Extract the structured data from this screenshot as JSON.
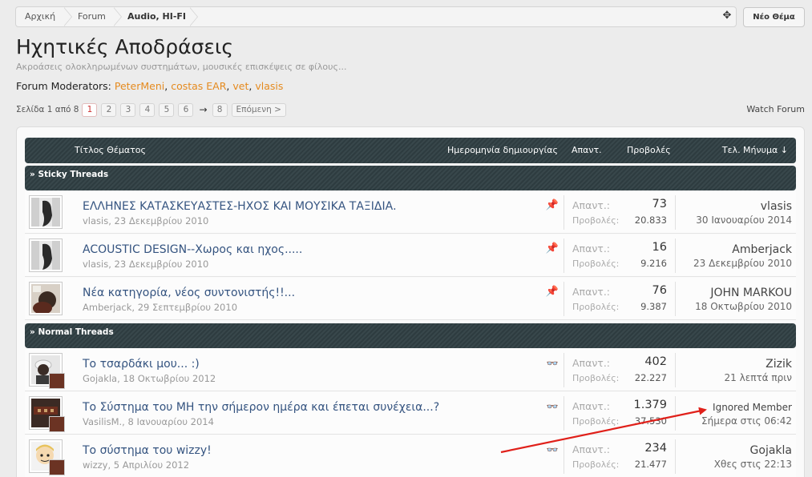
{
  "breadcrumb": [
    "Αρχική",
    "Forum",
    "Audio, HI-FI"
  ],
  "new_thread_label": "Νέο Θέμα",
  "forum": {
    "title": "Ηχητικές Αποδράσεις",
    "subtitle": "Ακροάσεις ολοκληρωμένων συστημάτων, μουσικές επισκέψεις σε φίλους...",
    "moderators_label": "Forum Moderators:",
    "moderators": [
      "PeterMeni",
      "costas EAR",
      "vet",
      "vlasis"
    ]
  },
  "pagination": {
    "label": "Σελίδα 1 από 8",
    "pages": [
      "1",
      "2",
      "3",
      "4",
      "5",
      "6"
    ],
    "arrow": "→",
    "last": "8",
    "next": "Επόμενη >"
  },
  "watch_forum": "Watch Forum",
  "table_header": {
    "title": "Τίτλος Θέματος",
    "date": "Ημερομηνία δημιουργίας",
    "replies": "Απαντ.",
    "views": "Προβολές",
    "last": "Τελ. Μήνυμα ↓"
  },
  "sections": {
    "sticky": "» Sticky Threads",
    "normal": "» Normal Threads"
  },
  "stat_labels": {
    "replies": "Απαντ.:",
    "views": "Προβολές:"
  },
  "threads": [
    {
      "title": "ΕΛΛΗΝΕΣ ΚΑΤΑΣΚΕΥΑΣΤΕΣ-ΗΧΟΣ ΚΑΙ ΜΟΥΣΙΚΑ ΤΑΞΙΔΙΑ.",
      "author": "vlasis",
      "date": "23 Δεκεμβρίου 2010",
      "replies": "73",
      "views": "20.833",
      "last_user": "vlasis",
      "last_date": "30 Ιανουαρίου 2014",
      "icon": "pin-icon"
    },
    {
      "title": "ACOUSTIC DESIGN--Χωρος και ηχος.....",
      "author": "vlasis",
      "date": "23 Δεκεμβρίου 2010",
      "replies": "16",
      "views": "9.216",
      "last_user": "Amberjack",
      "last_date": "23 Δεκεμβρίου 2010",
      "icon": "pin-icon"
    },
    {
      "title": "Νέα κατηγορία, νέος συντονιστής!!...",
      "author": "Amberjack",
      "date": "29 Σεπτεμβρίου 2010",
      "replies": "76",
      "views": "9.387",
      "last_user": "JOHN MARKOU",
      "last_date": "18 Οκτωβρίου 2010",
      "icon": "pin-icon"
    },
    {
      "title": "Το τσαρδάκι μου... :)",
      "author": "Gojakla",
      "date": "18 Οκτωβρίου 2012",
      "replies": "402",
      "views": "22.227",
      "last_user": "Zizik",
      "last_date": "21 λεπτά πριν",
      "icon": "glasses-icon"
    },
    {
      "title": "Το Σύστημα του ΜΗ την σήμερον ημέρα και έπεται συνέχεια...?",
      "author": "VasilisM.",
      "date": "8 Ιανουαρίου 2014",
      "replies": "1.379",
      "views": "37.530",
      "last_user": "Ignored Member",
      "last_date": "Σήμερα στις 06:42",
      "icon": "glasses-icon"
    },
    {
      "title": "Το σύστημα του wizzy!",
      "author": "wizzy",
      "date": "5 Απριλίου 2012",
      "replies": "234",
      "views": "21.477",
      "last_user": "Gojakla",
      "last_date": "Χθες στις 22:13",
      "icon": "glasses-icon"
    }
  ],
  "colors": {
    "accent_red": "#e0201a",
    "moderator": "#e58a1e",
    "title_link": "#355480"
  }
}
